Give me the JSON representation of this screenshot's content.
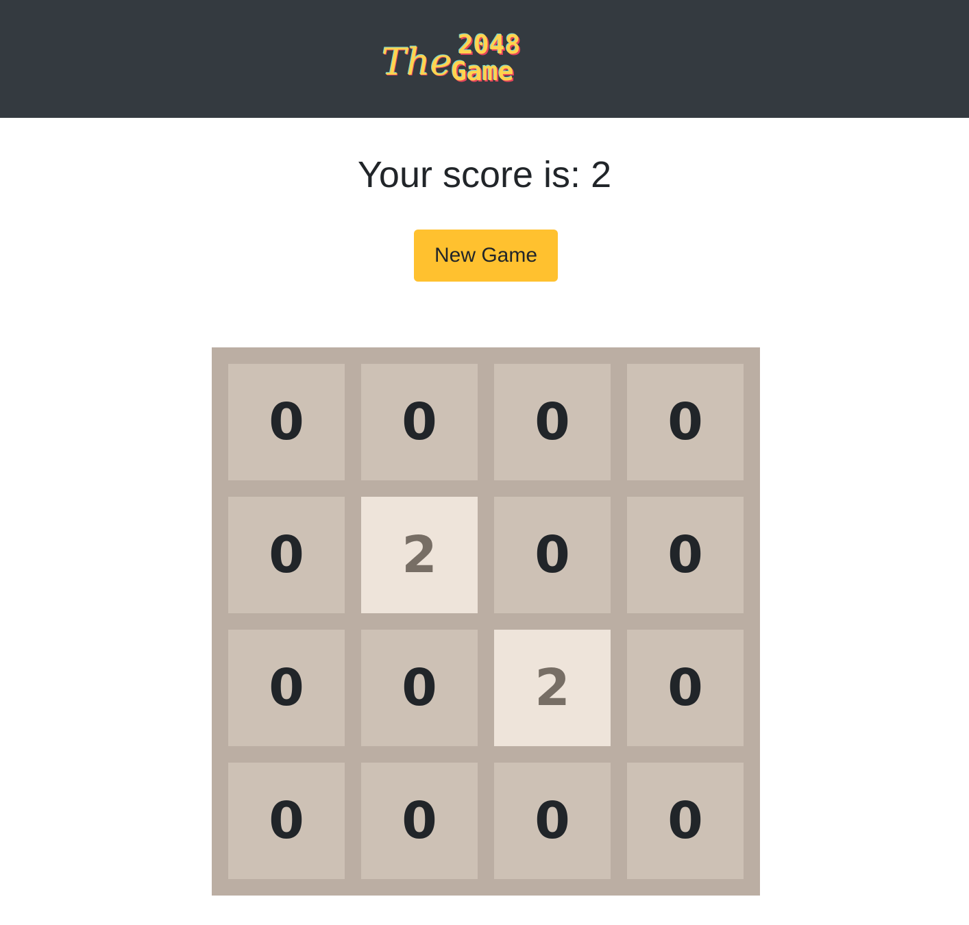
{
  "header": {
    "logo": {
      "script_text": "The",
      "number_text": "2048",
      "word_text": "Game",
      "icon": "game-logo"
    }
  },
  "score": {
    "label": "Your score is:",
    "value": "2"
  },
  "new_game_button": {
    "label": "New Game"
  },
  "board": {
    "rows": [
      [
        "0",
        "0",
        "0",
        "0"
      ],
      [
        "0",
        "2",
        "0",
        "0"
      ],
      [
        "0",
        "0",
        "2",
        "0"
      ],
      [
        "0",
        "0",
        "0",
        "0"
      ]
    ]
  },
  "colors": {
    "header_bg": "#343a40",
    "accent_yellow": "#ffc12f",
    "board_bg": "#bbaea3",
    "empty_tile": "#cdc1b5",
    "tile_2": "#eee4da",
    "tile_2_text": "#776e65",
    "text_dark": "#212529"
  }
}
